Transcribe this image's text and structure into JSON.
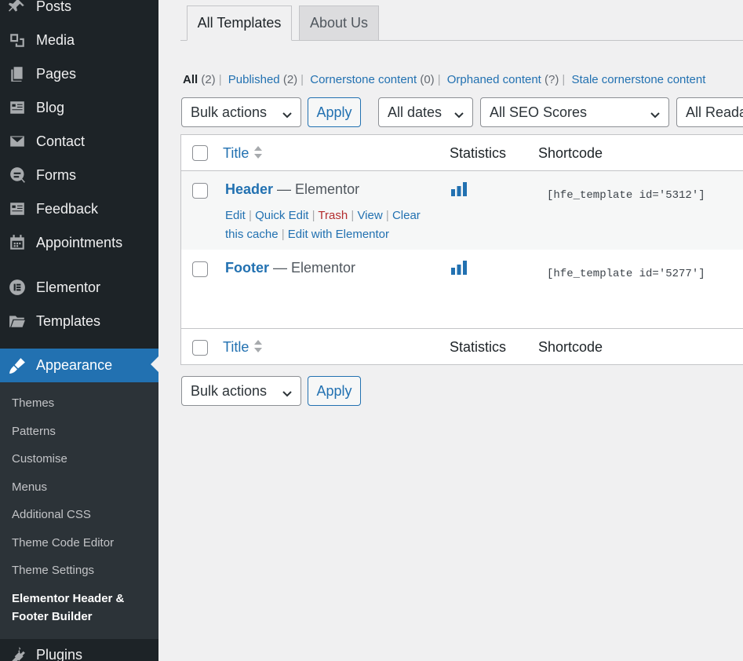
{
  "sidebar": {
    "menu": [
      {
        "label": "Posts",
        "icon": "pin-icon"
      },
      {
        "label": "Media",
        "icon": "media-icon"
      },
      {
        "label": "Pages",
        "icon": "pages-icon"
      },
      {
        "label": "Blog",
        "icon": "blog-icon"
      },
      {
        "label": "Contact",
        "icon": "envelope-icon"
      },
      {
        "label": "Forms",
        "icon": "forms-icon"
      },
      {
        "label": "Feedback",
        "icon": "feedback-icon"
      },
      {
        "label": "Appointments",
        "icon": "calendar-icon"
      },
      {
        "label": "Elementor",
        "icon": "elementor-icon"
      },
      {
        "label": "Templates",
        "icon": "folder-icon"
      },
      {
        "label": "Appearance",
        "icon": "brush-icon"
      },
      {
        "label": "Plugins",
        "icon": "plugin-icon"
      }
    ],
    "submenu": [
      {
        "label": "Themes"
      },
      {
        "label": "Patterns"
      },
      {
        "label": "Customise"
      },
      {
        "label": "Menus"
      },
      {
        "label": "Additional CSS"
      },
      {
        "label": "Theme Code Editor"
      },
      {
        "label": "Theme Settings"
      },
      {
        "label": "Elementor Header & Footer Builder"
      }
    ]
  },
  "tabs": [
    {
      "label": "All Templates",
      "active": true
    },
    {
      "label": "About Us",
      "active": false
    }
  ],
  "filters_links": {
    "all": "All",
    "all_count": "(2)",
    "published": "Published",
    "published_count": "(2)",
    "cornerstone": "Cornerstone content",
    "cornerstone_count": "(0)",
    "orphaned": "Orphaned content",
    "orphaned_count": "(?)",
    "stale": "Stale cornerstone content"
  },
  "toolbar": {
    "bulk_actions": "Bulk actions",
    "apply": "Apply",
    "all_dates": "All dates",
    "seo_scores": "All SEO Scores",
    "readability": "All Readability Scores"
  },
  "table": {
    "columns": {
      "title": "Title",
      "statistics": "Statistics",
      "shortcode": "Shortcode"
    },
    "rows": [
      {
        "title": "Header",
        "suffix": " — Elementor",
        "shortcode": "[hfe_template id='5312']"
      },
      {
        "title": "Footer",
        "suffix": " — Elementor",
        "shortcode": "[hfe_template id='5277']"
      }
    ],
    "row_actions": {
      "edit": "Edit",
      "quick_edit": "Quick Edit",
      "trash": "Trash",
      "view": "View",
      "clear_cache": "Clear this cache",
      "edit_elementor": "Edit with Elementor"
    }
  },
  "colors": {
    "accent": "#2271b1",
    "sidebar": "#1d2327",
    "trash": "#b32d2e"
  }
}
